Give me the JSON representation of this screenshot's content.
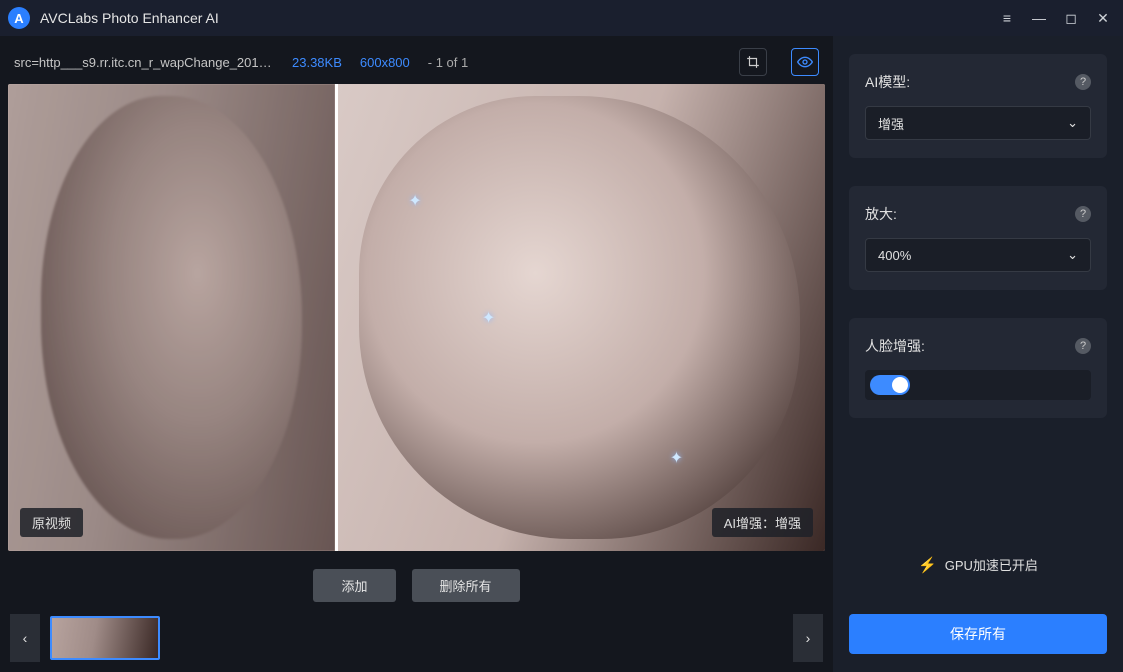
{
  "app": {
    "title": "AVCLabs Photo Enhancer AI"
  },
  "infobar": {
    "filename": "src=http___s9.rr.itc.cn_r_wapChange_20175…",
    "filesize": "23.38KB",
    "dimensions": "600x800",
    "counter": "- 1 of 1"
  },
  "preview": {
    "left_label": "原视频",
    "right_label": "AI增强：增强"
  },
  "actions": {
    "add": "添加",
    "remove_all": "删除所有"
  },
  "sidebar": {
    "model": {
      "label": "AI模型:",
      "value": "增强"
    },
    "scale": {
      "label": "放大:",
      "value": "400%"
    },
    "face": {
      "label": "人脸增强:",
      "on": true
    }
  },
  "footer": {
    "gpu_status": "GPU加速已开启",
    "save_all": "保存所有"
  }
}
